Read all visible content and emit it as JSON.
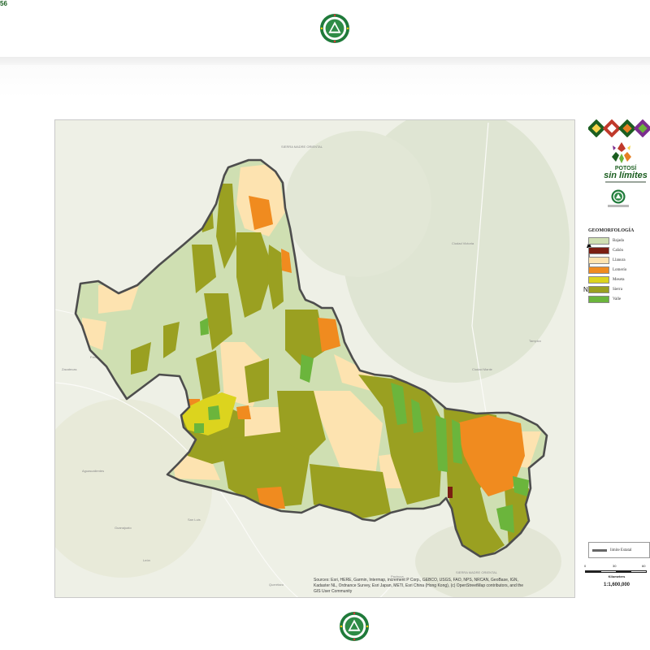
{
  "page": {
    "number": "56"
  },
  "map": {
    "attribution_line1": "Sources: Esri, HERE, Garmin, Intermap, increment P Corp., GEBCO, USGS, FAO, NPS, NRCAN, GeoBase, IGN,",
    "attribution_line2": "Kadaster NL, Ordnance Survey, Esri Japan, METI, Esri China (Hong Kong), (c) OpenStreetMap contributors, and the",
    "attribution_line3": "GIS User Community",
    "background_labels": [
      "SIERRA MADRE ORIENTAL",
      "SIERRA MADRE ORIENTAL",
      "Ciudad Victoria",
      "Ciudad Mante",
      "Tampico",
      "Aguascalientes",
      "Zacatecas",
      "León",
      "San Luis",
      "Querétaro",
      "Guanajuato",
      "Pachuca",
      "Ciudad Valles",
      "Fresnillo"
    ]
  },
  "branding": {
    "title": "POTOSÍ",
    "subtitle": "sin límites",
    "north_letter": "N"
  },
  "legend": {
    "title": "GEOMORFOLOGÍA",
    "items": [
      {
        "label": "Bajada",
        "color": "#cfdfb2"
      },
      {
        "label": "Cañón",
        "color": "#7a1e12"
      },
      {
        "label": "Llanura",
        "color": "#fde3b0"
      },
      {
        "label": "Lomerío",
        "color": "#f08b1f"
      },
      {
        "label": "Meseta",
        "color": "#dcd41e"
      },
      {
        "label": "Sierra",
        "color": "#9aa021"
      },
      {
        "label": "Valle",
        "color": "#6bb53c"
      }
    ],
    "boundary_label": "limite Estatal"
  },
  "scale": {
    "ticks": [
      "0",
      "30",
      "60"
    ],
    "unit": "Kilometers",
    "ratio": "1:1,600,000"
  },
  "colors": {
    "boundary": "#4d4d4d",
    "brand_green": "#1b5e20"
  },
  "icons": [
    "government-seal-icon",
    "north-arrow-icon",
    "brand-logo-icon"
  ]
}
